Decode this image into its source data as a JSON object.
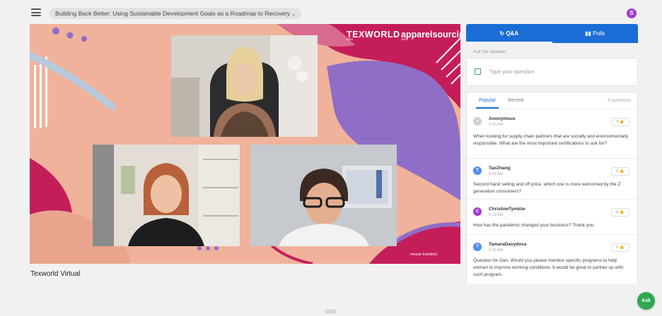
{
  "event": {
    "title": "Building Back Better: Using Sustainable Development Goals as a Roadmap to Recovery",
    "user_initial": "S"
  },
  "stage": {
    "brand_primary": "TEXWORLD",
    "brand_primary_sub": "USA",
    "brand_secondary": "apparelsourcing",
    "brand_secondary_sub": "USA",
    "sponsor": "messe frankfurt",
    "room_label": "Texworld Virtual"
  },
  "panel": {
    "tab_qa": "Q&A",
    "tab_polls": "Polls",
    "ask_label": "Ask the speaker",
    "input_placeholder": "Type your question",
    "subtab_popular": "Popular",
    "subtab_recent": "Recent",
    "question_count": "4 questions",
    "questions": [
      {
        "author": "Anonymous",
        "time": "9:20 AM",
        "likes": "7",
        "avatar_initial": "",
        "avatar_color": "#cfcfcf",
        "text": "When looking for supply chain partners that are socially and environmentally responsible. What are the most important certifications to ask for?"
      },
      {
        "author": "TaoZhang",
        "time": "9:26 AM",
        "likes": "0",
        "avatar_initial": "T",
        "avatar_color": "#4f8ef0",
        "text": "Second hand selling and off price, which one is more welcomed by the Z generation consumers?"
      },
      {
        "author": "ChristineTymkiw",
        "time": "9:19 AM",
        "likes": "0",
        "avatar_initial": "C",
        "avatar_color": "#a23ad1",
        "text": "How has the pandemic changed your business? Thank you"
      },
      {
        "author": "TamaraDavydova",
        "time": "9:25 AM",
        "likes": "0",
        "avatar_initial": "T",
        "avatar_color": "#4f8ef0",
        "text": "Question for Dan. Would you please mention specific programs to help women to improve working conditions. It would be great to partner up with such program."
      }
    ]
  },
  "ask_button": "Ask",
  "footer_brand": "slido",
  "colors": {
    "accent_blue": "#1a6dd6",
    "accent_green": "#2fa84f",
    "stage_pink": "#f0b29a",
    "stage_magenta": "#c41e5a",
    "stage_purple": "#8f6ec7"
  }
}
